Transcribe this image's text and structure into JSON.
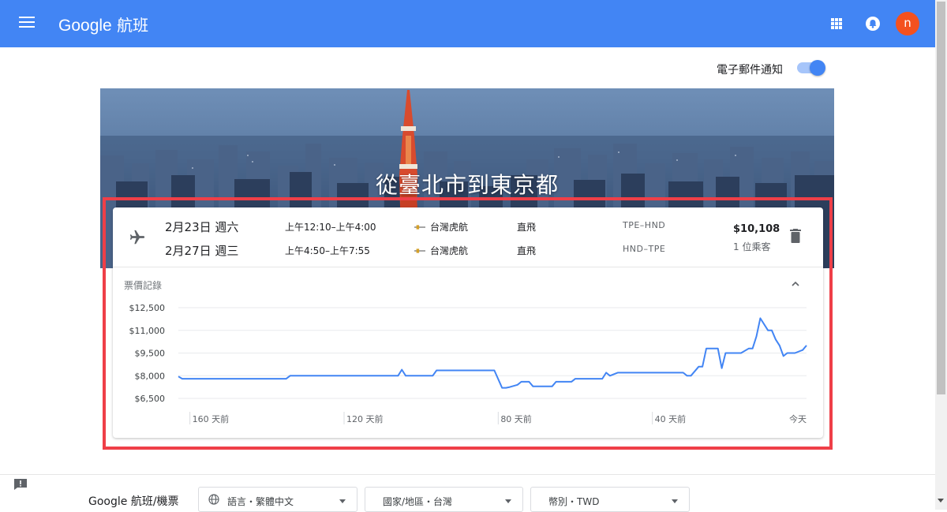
{
  "header": {
    "brand": "Google",
    "product": "航班",
    "avatar_letter": "n",
    "color": "#4285f4",
    "icons": [
      "menu-icon",
      "apps-icon",
      "bell-icon"
    ]
  },
  "notify": {
    "label": "電子郵件通知",
    "enabled": true
  },
  "trip": {
    "title": "從臺北市到東京都",
    "legs": [
      {
        "date": "2月23日 週六",
        "time": "上午12:10–上午4:00",
        "airline": "台灣虎航",
        "stops": "直飛",
        "route": "TPE–HND"
      },
      {
        "date": "2月27日 週三",
        "time": "上午4:50–上午7:55",
        "airline": "台灣虎航",
        "stops": "直飛",
        "route": "HND–TPE"
      }
    ],
    "price": "$10,108",
    "passengers": "1 位乘客"
  },
  "history": {
    "label": "票價記錄"
  },
  "chart_data": {
    "type": "line",
    "x_unit_label": "天前",
    "xlim": [
      -163,
      0
    ],
    "ylim": [
      6500,
      12500
    ],
    "y_ticks": [
      12500,
      11000,
      9500,
      8000,
      6500
    ],
    "y_tick_labels": [
      "$12,500",
      "$11,000",
      "$9,500",
      "$8,000",
      "$6,500"
    ],
    "x_ticks": [
      -160,
      -120,
      -80,
      -40,
      0
    ],
    "x_tick_labels": [
      "160 天前",
      "120 天前",
      "80 天前",
      "40 天前",
      "今天"
    ],
    "grid": true,
    "color": "#4285f4",
    "series": [
      {
        "x": [
          -163,
          -162,
          -135,
          -134,
          -120,
          -106,
          -105,
          -104,
          -102,
          -97,
          -96,
          -94,
          -81,
          -79,
          -78,
          -77,
          -75,
          -74,
          -72,
          -71,
          -69,
          -66,
          -65,
          -61,
          -60,
          -53,
          -52,
          -51,
          -49,
          -48,
          -45,
          -44,
          -43,
          -42,
          -41,
          -32,
          -31,
          -30,
          -28,
          -27,
          -26,
          -24,
          -23,
          -22,
          -21,
          -19,
          -18,
          -17,
          -15,
          -14,
          -13,
          -12,
          -10,
          -9,
          -8,
          -7,
          -6,
          -5,
          -4,
          -3,
          -1,
          0
        ],
        "y": [
          7950,
          7800,
          7800,
          8000,
          8000,
          8000,
          8400,
          8000,
          8000,
          8000,
          8350,
          8350,
          8350,
          7200,
          7200,
          7250,
          7400,
          7600,
          7600,
          7300,
          7300,
          7300,
          7600,
          7600,
          7800,
          7800,
          8200,
          8000,
          8200,
          8200,
          8200,
          8200,
          8200,
          8200,
          8200,
          8200,
          8000,
          8000,
          8600,
          8600,
          9800,
          9800,
          9800,
          8500,
          9500,
          9500,
          9500,
          9500,
          9800,
          9800,
          10600,
          11800,
          11000,
          11000,
          10400,
          10000,
          9300,
          9500,
          9500,
          9500,
          9700,
          10000
        ]
      }
    ]
  },
  "footer": {
    "brand": "Google 航班/機票",
    "language": "語言・繁體中文",
    "region": "國家/地區・台灣",
    "currency": "幣別・TWD"
  }
}
